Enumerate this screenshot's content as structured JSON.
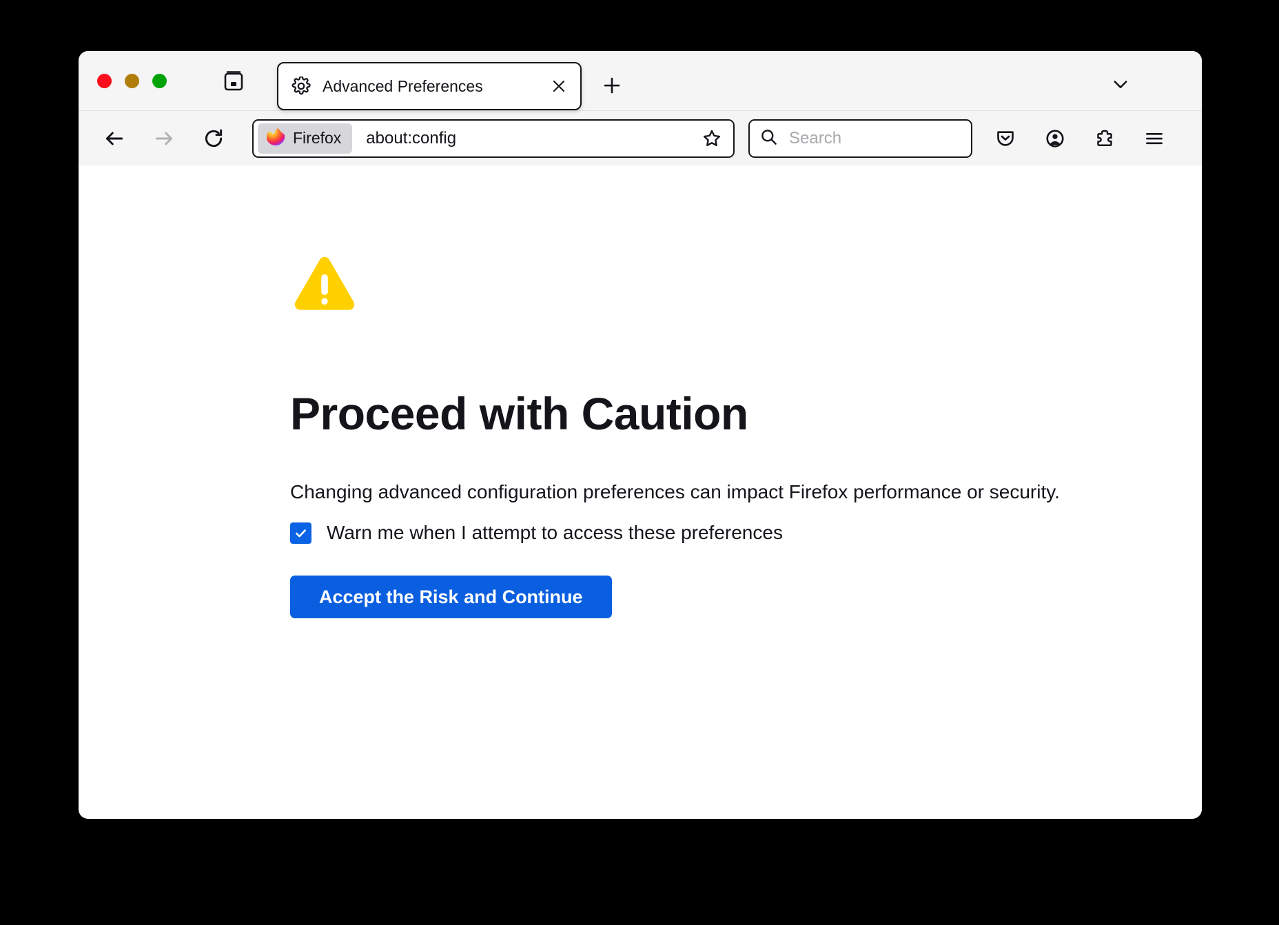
{
  "window": {
    "traffic_lights": [
      {
        "name": "close",
        "color": "#fc0d1b"
      },
      {
        "name": "minimize",
        "color": "#b07d0b"
      },
      {
        "name": "zoom",
        "color": "#00a306"
      }
    ]
  },
  "tabstrip": {
    "firefox_view_icon": "firefox-view-icon",
    "tabs": [
      {
        "title": "Advanced Preferences",
        "favicon": "gear-icon",
        "close_icon": "close-icon",
        "active": true
      }
    ],
    "new_tab_icon": "plus-icon",
    "all_tabs_icon": "chevron-down-icon"
  },
  "navbar": {
    "back_icon": "arrow-left-icon",
    "forward_icon": "arrow-right-icon",
    "reload_icon": "reload-icon",
    "urlbar": {
      "identity_label": "Firefox",
      "identity_icon": "firefox-logo-icon",
      "url": "about:config",
      "bookmark_icon": "star-icon"
    },
    "search": {
      "icon": "search-icon",
      "placeholder": "Search",
      "value": ""
    },
    "icons": [
      {
        "name": "pocket-icon",
        "label": "Save to Pocket"
      },
      {
        "name": "account-icon",
        "label": "Account"
      },
      {
        "name": "extensions-icon",
        "label": "Extensions"
      },
      {
        "name": "menu-icon",
        "label": "Open application menu"
      }
    ]
  },
  "content": {
    "warning_icon": "warning-triangle-icon",
    "title": "Proceed with Caution",
    "description": "Changing advanced configuration preferences can impact Firefox performance or security.",
    "checkbox": {
      "label": "Warn me when I attempt to access these preferences",
      "checked": true
    },
    "accept_button": "Accept the Risk and Continue"
  },
  "colors": {
    "accent_blue": "#0a5fe0",
    "checkbox_blue": "#0a63e4",
    "warning_yellow": "#ffd000",
    "text_dark": "#15141a",
    "chrome_gray": "#f5f5f5",
    "backdrop": "#000000"
  }
}
